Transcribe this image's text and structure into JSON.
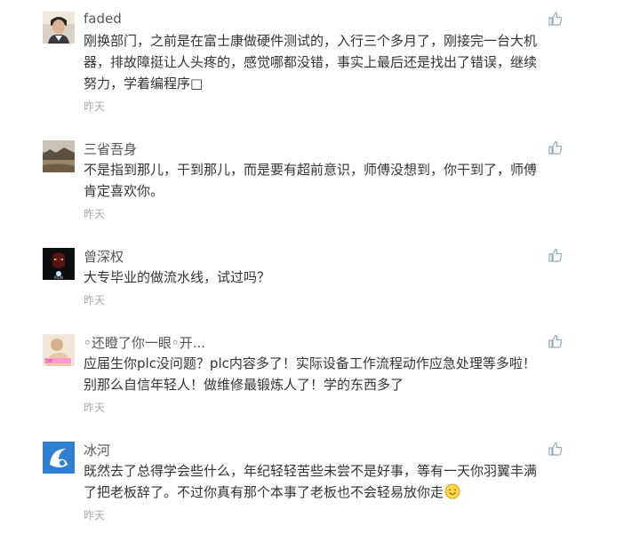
{
  "comments": [
    {
      "username": "faded",
      "lines": [
        "刚换部门，之前是在富士康做硬件测试的，入行三个多月了，刚接完一台大机",
        "器，排故障挺让人头疼的，感觉哪都没错，事实上最后还是找出了错误，继续",
        "努力，学着编程序□"
      ],
      "time": "昨天",
      "avatar_icon": "person-photo-avatar",
      "like_icon": "thumbs-up-icon"
    },
    {
      "username": "三省吾身",
      "lines": [
        "不是指到那儿，干到那儿，而是要有超前意识，师傅没想到，你干到了，师傅",
        "肯定喜欢你。"
      ],
      "time": "昨天",
      "avatar_icon": "landscape-photo-avatar",
      "like_icon": "thumbs-up-icon"
    },
    {
      "username": "曾深权",
      "lines": [
        "大专毕业的做流水线，试过吗？"
      ],
      "time": "昨天",
      "avatar_icon": "iron-man-avatar",
      "like_icon": "thumbs-up-icon"
    },
    {
      "username": "◦还瞪了你一眼◦开...",
      "lines": [
        "应届生你plc没问题？plc内容多了！实际设备工作流程动作应急处理等多啦！",
        "别那么自信年轻人！做维修最锻炼人了！学的东西多了"
      ],
      "time": "昨天",
      "avatar_icon": "cartoon-photo-avatar",
      "like_icon": "thumbs-up-icon"
    },
    {
      "username": "冰河",
      "lines": [
        "既然去了总得学会些什么，年纪轻轻苦些未尝不是好事，等有一天你羽翼丰满",
        "了把老板辞了。不过你真有那个本事了老板也不会轻易放你走"
      ],
      "time": "昨天",
      "avatar_icon": "blue-logo-avatar",
      "like_icon": "thumbs-up-icon",
      "trailing_icon": "smiley-emoji-icon"
    }
  ]
}
